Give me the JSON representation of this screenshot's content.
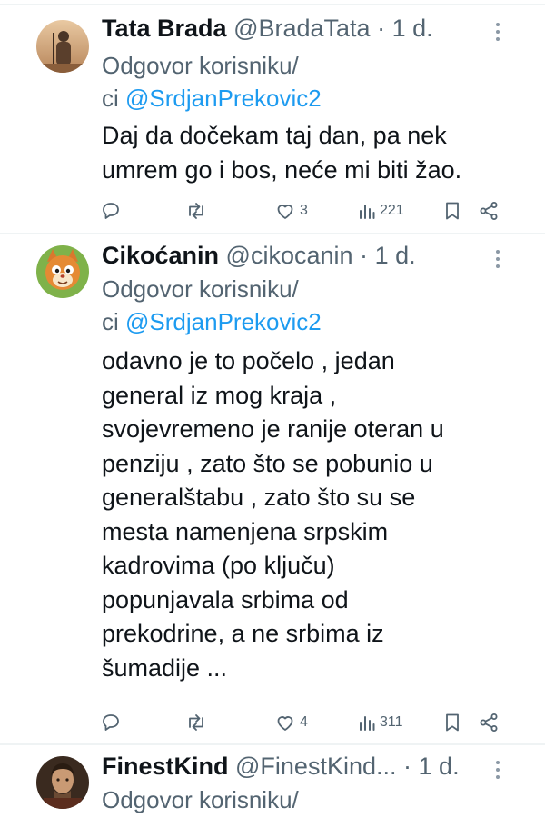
{
  "tweets": [
    {
      "name": "Tata Brada",
      "handle": "@BradaTata",
      "separator": "·",
      "time": "1 d.",
      "reply_prefix": "Odgovor korisniku/",
      "reply_ci": "ci",
      "reply_mention": "@SrdjanPrekovic2",
      "text_lines": [
        "Daj da dočekam taj dan, pa nek",
        "umrem go i bos, neće mi biti žao."
      ],
      "likes": "3",
      "views": "221",
      "avatar_icon": "man-silhouette-avatar"
    },
    {
      "name": "Cikoćanin",
      "handle": "@cikocanin",
      "separator": "·",
      "time": "1 d.",
      "reply_prefix": "Odgovor korisniku/",
      "reply_ci": "ci",
      "reply_mention": "@SrdjanPrekovic2",
      "text_lines": [
        "odavno je to počelo , jedan",
        "general iz mog kraja ,",
        "svojevremeno je ranije oteran u",
        "penziju , zato što se pobunio u",
        "generalštabu , zato što su se",
        "mesta namenjena srpskim",
        "kadrovima (po ključu)",
        "popunjavala srbima od",
        "prekodrine,  a ne srbima iz",
        "šumadije ..."
      ],
      "likes": "4",
      "views": "311",
      "avatar_icon": "cartoon-cat-avatar"
    },
    {
      "name": "FinestKind",
      "handle": "@FinestKind...",
      "separator": "·",
      "time": "1 d.",
      "reply_prefix": "Odgovor korisniku/",
      "avatar_icon": "man-portrait-avatar"
    }
  ],
  "colors": {
    "text": "#0f1419",
    "secondary": "#536471",
    "mention": "#1d9bf0",
    "divider": "#eff3f4"
  }
}
